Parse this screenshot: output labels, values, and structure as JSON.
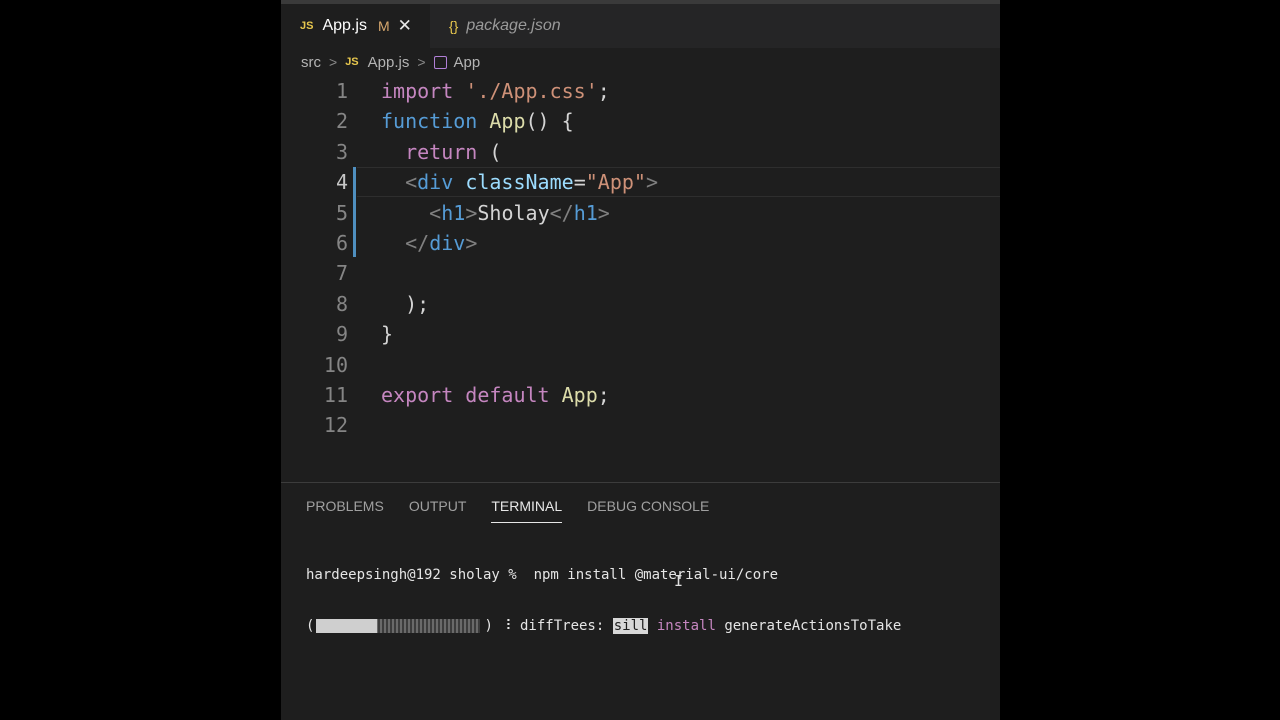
{
  "tabs": [
    {
      "badge": "JS",
      "label": "App.js",
      "modified": "M",
      "close": "✕",
      "active": true
    },
    {
      "badge": "{}",
      "label": "package.json",
      "active": false
    }
  ],
  "breadcrumb": {
    "folder": "src",
    "file_badge": "JS",
    "file": "App.js",
    "symbol": "App"
  },
  "editor": {
    "active_line": 4,
    "lines": [
      {
        "n": "1",
        "tokens": [
          {
            "t": "import",
            "c": "kw"
          },
          {
            "t": " "
          },
          {
            "t": "'./App.css'",
            "c": "str"
          },
          {
            "t": ";"
          }
        ]
      },
      {
        "n": "2",
        "tokens": [
          {
            "t": "function",
            "c": "tag"
          },
          {
            "t": " "
          },
          {
            "t": "App",
            "c": "fn"
          },
          {
            "t": "() {"
          }
        ]
      },
      {
        "n": "3",
        "tokens": [
          {
            "t": "  "
          },
          {
            "t": "return",
            "c": "kw"
          },
          {
            "t": " ("
          }
        ]
      },
      {
        "n": "4",
        "tokens": [
          {
            "t": "  "
          },
          {
            "t": "<",
            "c": "punct"
          },
          {
            "t": "div",
            "c": "tag"
          },
          {
            "t": " "
          },
          {
            "t": "className",
            "c": "attr"
          },
          {
            "t": "="
          },
          {
            "t": "\"App\"",
            "c": "str"
          },
          {
            "t": ">",
            "c": "punct"
          }
        ]
      },
      {
        "n": "5",
        "tokens": [
          {
            "t": "    "
          },
          {
            "t": "<",
            "c": "punct"
          },
          {
            "t": "h1",
            "c": "tag"
          },
          {
            "t": ">",
            "c": "punct"
          },
          {
            "t": "Sholay"
          },
          {
            "t": "</",
            "c": "punct"
          },
          {
            "t": "h1",
            "c": "tag"
          },
          {
            "t": ">",
            "c": "punct"
          }
        ]
      },
      {
        "n": "6",
        "tokens": [
          {
            "t": "  "
          },
          {
            "t": "</",
            "c": "punct"
          },
          {
            "t": "div",
            "c": "tag"
          },
          {
            "t": ">",
            "c": "punct"
          }
        ]
      },
      {
        "n": "7",
        "tokens": []
      },
      {
        "n": "8",
        "tokens": [
          {
            "t": "  );"
          }
        ]
      },
      {
        "n": "9",
        "tokens": [
          {
            "t": "}"
          }
        ]
      },
      {
        "n": "10",
        "tokens": []
      },
      {
        "n": "11",
        "tokens": [
          {
            "t": "export",
            "c": "kw"
          },
          {
            "t": " "
          },
          {
            "t": "default",
            "c": "kw"
          },
          {
            "t": " "
          },
          {
            "t": "App",
            "c": "fn"
          },
          {
            "t": ";"
          }
        ]
      },
      {
        "n": "12",
        "tokens": []
      }
    ]
  },
  "panel": {
    "tabs": [
      "PROBLEMS",
      "OUTPUT",
      "TERMINAL",
      "DEBUG CONSOLE"
    ],
    "active_tab": "TERMINAL"
  },
  "terminal": {
    "prompt": "hardeepsingh@192 sholay %  npm install @material-ui/core",
    "progress_fraction": 0.37,
    "progress_open": "(",
    "progress_close": ")",
    "spinner": " ⠸ ",
    "stage": "diffTrees: ",
    "level": "sill",
    "verb": "install",
    "message": " generateActionsToTake"
  },
  "colors": {
    "accent": "#4f8fbf",
    "keyword": "#c586c0",
    "string": "#ce9178",
    "function": "#dcdcaa"
  }
}
